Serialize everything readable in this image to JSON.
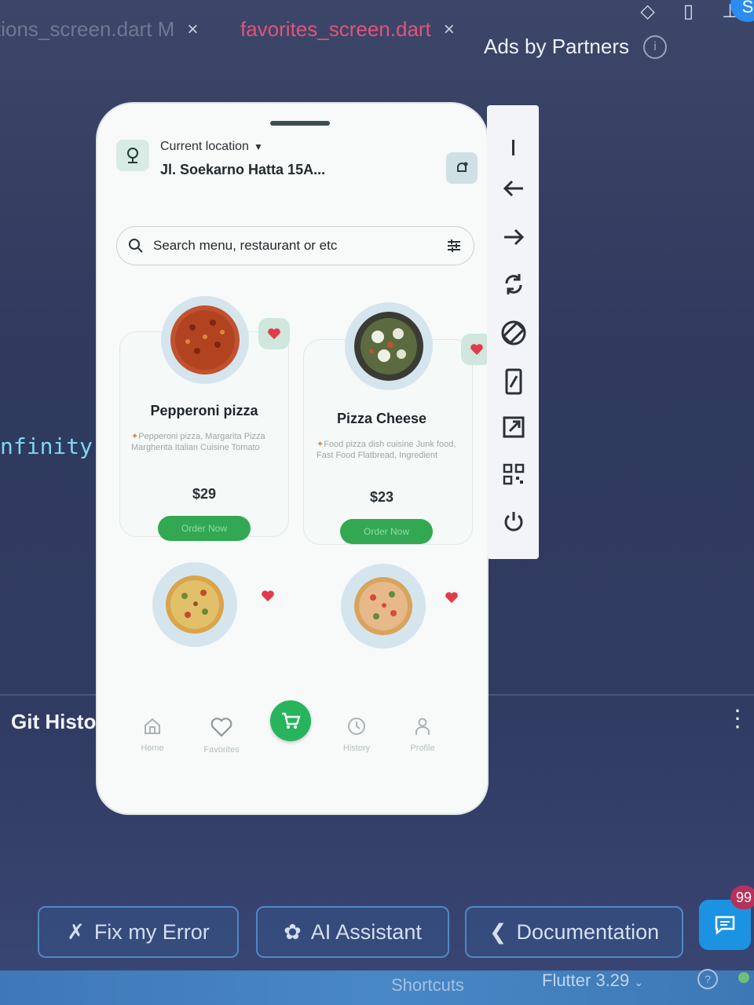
{
  "ide": {
    "tabs": [
      {
        "label": "tions_screen.dart M"
      },
      {
        "label": "favorites_screen.dart"
      }
    ],
    "tab_close": "×",
    "ads_label": "Ads by Partners",
    "info_glyph": "i",
    "code_fragment": "nfinity)",
    "git_history": "Git Histor",
    "avatar_letter": "S"
  },
  "app": {
    "location_label": "Current location",
    "location_value": "Jl. Soekarno Hatta 15A...",
    "search_placeholder": "Search menu, restaurant or etc",
    "foods": [
      {
        "name": "Pepperoni pizza",
        "description": "Pepperoni pizza, Margarita Pizza Margherita Italian Cuisine Tomato",
        "price": "$29",
        "order_label": "Order Now"
      },
      {
        "name": "Pizza Cheese",
        "description": "Food pizza dish cuisine Junk food, Fast Food Flatbread, Ingredient",
        "price": "$23",
        "order_label": "Order Now"
      }
    ],
    "nav": {
      "home": "Home",
      "favorites": "Favorites",
      "history": "History",
      "profile": "Profile"
    }
  },
  "actions": {
    "fix_error": "Fix my Error",
    "ai_assistant": "AI Assistant",
    "documentation": "Documentation",
    "chat_badge": "99"
  },
  "status_bar": {
    "shortcuts": "Shortcuts",
    "flutter_version": "Flutter 3.29",
    "help_glyph": "?"
  },
  "colors": {
    "brand_green": "#33a853",
    "heart_red": "#e23b4a",
    "active_tab": "#e0547a",
    "ide_bg": "#303b62"
  }
}
